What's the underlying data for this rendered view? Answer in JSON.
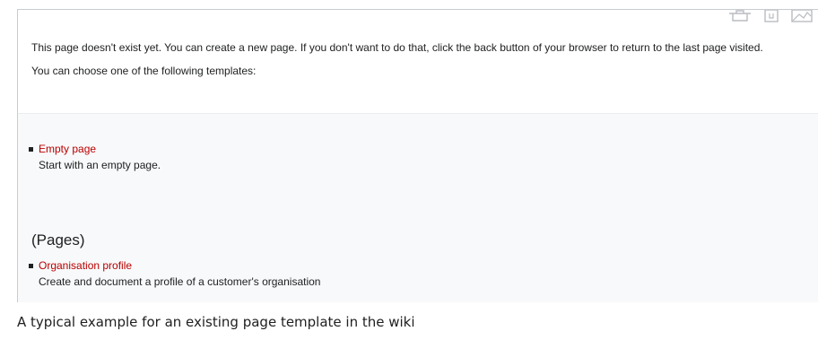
{
  "notice": {
    "missing_page_text": "This page doesn't exist yet. You can create a new page. If you don't want to do that, click the back button of your browser to return to the last page visited.",
    "choose_template_text": "You can choose one of the following templates:"
  },
  "toolbar": {
    "icons": [
      "print-icon",
      "page-icon",
      "image-icon"
    ]
  },
  "templates": {
    "default": [
      {
        "link": "Empty page",
        "description": "Start with an empty page."
      }
    ],
    "group_heading": "(Pages)",
    "pages": [
      {
        "link": "Organisation profile",
        "description": "Create and document a profile of a customer's organisation"
      }
    ]
  },
  "caption": "A typical example for an existing page template in the wiki",
  "colors": {
    "link_red": "#ba0000",
    "text": "#202122",
    "border": "#c8ccd1",
    "box_bg": "#f8f9fa"
  }
}
